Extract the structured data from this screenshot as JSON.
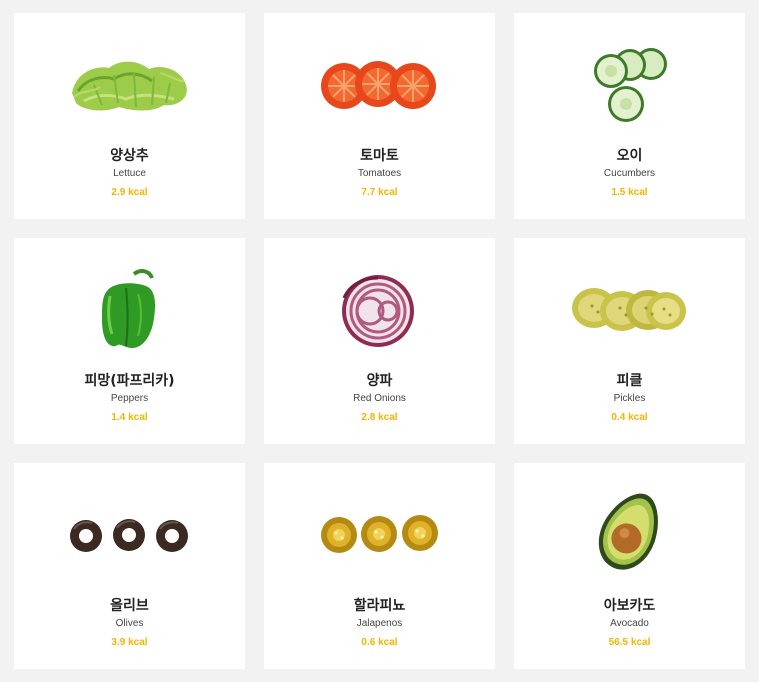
{
  "colors": {
    "background": "#f2f2f2",
    "card": "#ffffff",
    "kcal": "#f6b300"
  },
  "items": [
    {
      "name_ko": "양상추",
      "name_en": "Lettuce",
      "kcal": "2.9 kcal",
      "icon": "lettuce-icon"
    },
    {
      "name_ko": "토마토",
      "name_en": "Tomatoes",
      "kcal": "7.7 kcal",
      "icon": "tomato-icon"
    },
    {
      "name_ko": "오이",
      "name_en": "Cucumbers",
      "kcal": "1.5 kcal",
      "icon": "cucumber-icon"
    },
    {
      "name_ko": "피망(파프리카)",
      "name_en": "Peppers",
      "kcal": "1.4 kcal",
      "icon": "pepper-icon"
    },
    {
      "name_ko": "양파",
      "name_en": "Red Onions",
      "kcal": "2.8 kcal",
      "icon": "onion-icon"
    },
    {
      "name_ko": "피클",
      "name_en": "Pickles",
      "kcal": "0.4 kcal",
      "icon": "pickle-icon"
    },
    {
      "name_ko": "올리브",
      "name_en": "Olives",
      "kcal": "3.9 kcal",
      "icon": "olive-icon"
    },
    {
      "name_ko": "할라피뇨",
      "name_en": "Jalapenos",
      "kcal": "0.6 kcal",
      "icon": "jalapeno-icon"
    },
    {
      "name_ko": "아보카도",
      "name_en": "Avocado",
      "kcal": "56.5 kcal",
      "icon": "avocado-icon"
    }
  ]
}
